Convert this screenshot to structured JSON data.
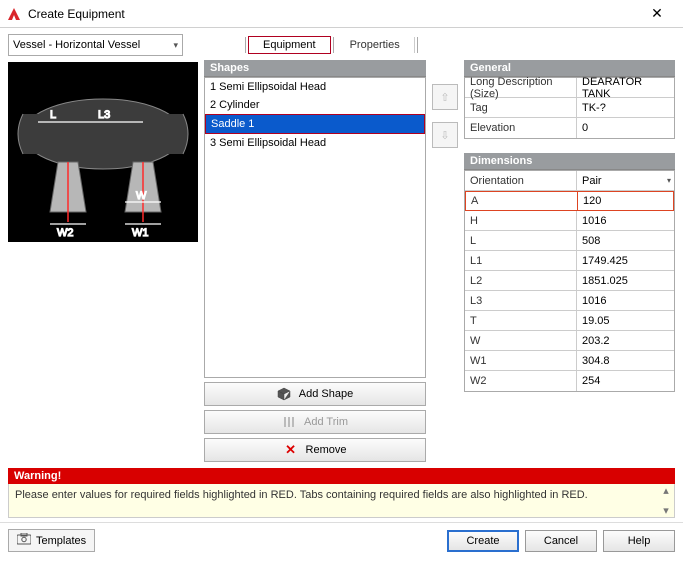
{
  "title": "Create Equipment",
  "typeDropdown": {
    "value": "Vessel - Horizontal Vessel"
  },
  "tabs": [
    "Equipment",
    "Properties"
  ],
  "shapes": {
    "header": "Shapes",
    "items": [
      "1 Semi Ellipsoidal Head",
      "2 Cylinder",
      "Saddle 1",
      "3 Semi Ellipsoidal Head"
    ],
    "selectedIndex": 2,
    "buttons": {
      "add": "Add Shape",
      "trim": "Add Trim",
      "remove": "Remove"
    }
  },
  "general": {
    "header": "General",
    "rows": [
      {
        "k": "Long Description (Size)",
        "v": "DEARATOR TANK"
      },
      {
        "k": "Tag",
        "v": "TK-?"
      },
      {
        "k": "Elevation",
        "v": "0"
      }
    ]
  },
  "dimensions": {
    "header": "Dimensions",
    "rows": [
      {
        "k": "Orientation",
        "v": "Pair"
      },
      {
        "k": "A",
        "v": "120",
        "required": true
      },
      {
        "k": "H",
        "v": "1016"
      },
      {
        "k": "L",
        "v": "508"
      },
      {
        "k": "L1",
        "v": "1749.425"
      },
      {
        "k": "L2",
        "v": "1851.025"
      },
      {
        "k": "L3",
        "v": "1016"
      },
      {
        "k": "T",
        "v": "19.05"
      },
      {
        "k": "W",
        "v": "203.2"
      },
      {
        "k": "W1",
        "v": "304.8"
      },
      {
        "k": "W2",
        "v": "254"
      }
    ]
  },
  "warning": {
    "header": "Warning!",
    "text": "Please enter values for required fields highlighted in RED. Tabs containing required fields are also highlighted in RED."
  },
  "footer": {
    "templates": "Templates",
    "create": "Create",
    "cancel": "Cancel",
    "help": "Help"
  }
}
